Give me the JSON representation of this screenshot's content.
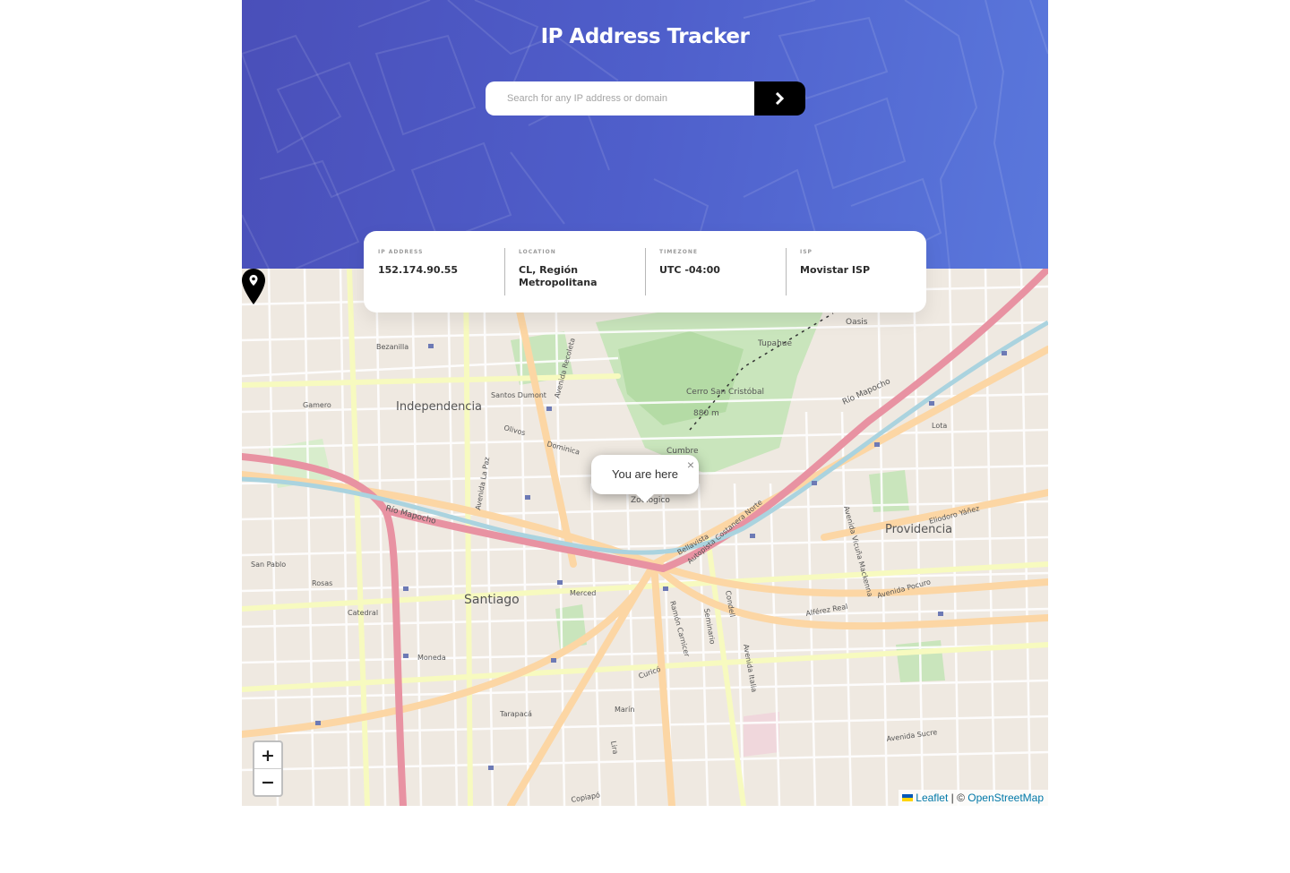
{
  "header": {
    "title": "IP Address Tracker"
  },
  "search": {
    "placeholder": "Search for any IP address or domain",
    "value": "",
    "button_icon": "chevron-right-icon"
  },
  "stats": [
    {
      "label": "IP ADDRESS",
      "value": "152.174.90.55"
    },
    {
      "label": "LOCATION",
      "value": "CL, Región Metropolitana"
    },
    {
      "label": "TIMEZONE",
      "value": "UTC -04:00"
    },
    {
      "label": "ISP",
      "value": "Movistar ISP"
    }
  ],
  "map": {
    "popup_text": "You are here",
    "zoom_in": "+",
    "zoom_out": "−",
    "attribution": {
      "leaflet": "Leaflet",
      "separator": " | © ",
      "osm": "OpenStreetMap"
    },
    "labels": {
      "independencia": "Independencia",
      "santiago": "Santiago",
      "providencia": "Providencia",
      "cerro": "Cerro San Cristóbal",
      "cerro_alt": "880 m",
      "rio_mapocho_west": "Río Mapocho",
      "rio_mapocho_east": "Río Mapocho",
      "bellavista": "Bellavista",
      "autopista": "Autopista Costanera Norte",
      "mercado": "Merced",
      "recoleta": "Avenida Recoleta",
      "santos_dumont": "Santos Dumont",
      "dominica": "Dominica",
      "olivos": "Olivos",
      "rosas": "Rosas",
      "catedral": "Catedral",
      "moneda": "Moneda",
      "tarapaca": "Tarapacá",
      "curico": "Curicó",
      "marin": "Marín",
      "lira": "Lira",
      "condell": "Condell",
      "seminario": "Seminario",
      "avenida_italia": "Avenida Italia",
      "alferez_real": "Alférez Real",
      "avenida_pocuro": "Avenida Pocuro",
      "avenida_sucre": "Avenida Sucre",
      "eliodoro": "Eliodoro Yáñez",
      "tupahue": "Tupahue",
      "oasis": "Oasis",
      "cumbre": "Cumbre",
      "zoologico": "Zoológico",
      "bezanilla": "Bezanilla",
      "gamero": "Gamero",
      "la_paz": "Avenida La Paz",
      "san_pablo": "San Pablo",
      "avenida_vicuna": "Avenida Vicuña Mackenna",
      "lota": "Lota",
      "ramon_carnicer": "Ramón Carnicer",
      "copiapo": "Copiapó"
    }
  },
  "colors": {
    "hero_start": "#4a4fb9",
    "hero_end": "#5a78dc",
    "button": "#000000",
    "link": "#0078a8"
  }
}
